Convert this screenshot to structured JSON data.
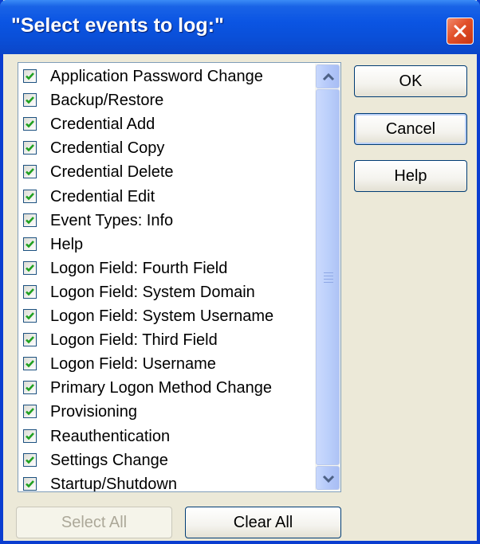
{
  "window": {
    "title": "\"Select events to log:\"",
    "close_icon": "close-x-icon"
  },
  "event_list": {
    "items": [
      {
        "label": "Application Password Change",
        "checked": true
      },
      {
        "label": "Backup/Restore",
        "checked": true
      },
      {
        "label": "Credential Add",
        "checked": true
      },
      {
        "label": "Credential Copy",
        "checked": true
      },
      {
        "label": "Credential Delete",
        "checked": true
      },
      {
        "label": "Credential Edit",
        "checked": true
      },
      {
        "label": "Event Types: Info",
        "checked": true
      },
      {
        "label": "Help",
        "checked": true
      },
      {
        "label": "Logon Field: Fourth Field",
        "checked": true
      },
      {
        "label": "Logon Field: System Domain",
        "checked": true
      },
      {
        "label": "Logon Field:  System Username",
        "checked": true
      },
      {
        "label": "Logon Field: Third Field",
        "checked": true
      },
      {
        "label": "Logon Field: Username",
        "checked": true
      },
      {
        "label": "Primary Logon Method Change",
        "checked": true
      },
      {
        "label": "Provisioning",
        "checked": true
      },
      {
        "label": "Reauthentication",
        "checked": true
      },
      {
        "label": "Settings Change",
        "checked": true
      },
      {
        "label": "Startup/Shutdown",
        "checked": true
      }
    ]
  },
  "buttons": {
    "ok": "OK",
    "cancel": "Cancel",
    "help": "Help",
    "select_all": "Select All",
    "clear_all": "Clear All"
  },
  "colors": {
    "title_bar": "#0b55e3",
    "close_button": "#e2502a",
    "checkmark": "#21a121",
    "dialog_background": "#ece9d8"
  }
}
